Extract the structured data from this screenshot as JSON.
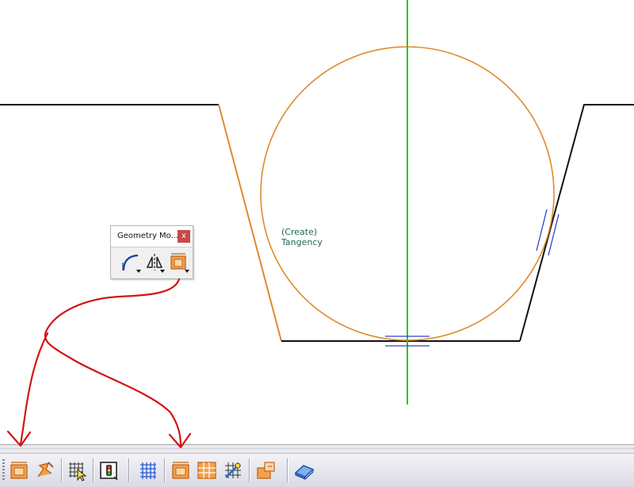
{
  "canvas": {
    "hint_line1": "(Create)",
    "hint_line2": "Tangency",
    "colors": {
      "profile": "#111111",
      "circle": "#e08a2c",
      "axis": "#22cc22",
      "constraint": "#3040c8",
      "annotation_arrow": "#d21414"
    }
  },
  "floating_toolbar": {
    "title": "Geometry Mo...",
    "close_label": "x",
    "tools": [
      "corner-icon",
      "mirror-icon",
      "sketch-frame-icon"
    ]
  },
  "bottom_toolbar": {
    "buttons": [
      "sketch-frame-icon",
      "profile-edit-icon",
      "grid-select-icon",
      "constraint-display-icon",
      "grid-icon",
      "sketch-frame-icon",
      "frame-grid-icon",
      "cut-constraint-icon",
      "output-feature-icon",
      "sketch-plane-icon"
    ]
  }
}
